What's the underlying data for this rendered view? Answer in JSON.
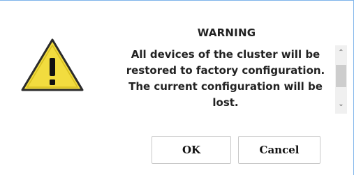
{
  "dialog": {
    "title": "WARNING",
    "message": "All devices of the cluster will be restored to factory configuration. The current configuration will be lost.",
    "icon": "warning-triangle-icon",
    "colors": {
      "icon_fill": "#f2dc3f",
      "icon_border": "#2b2b2b",
      "frame_border": "#7eb4ea"
    }
  },
  "buttons": {
    "ok_label": "OK",
    "cancel_label": "Cancel"
  },
  "scrollbar": {
    "up_arrow": "⌃",
    "down_arrow": "⌄"
  }
}
